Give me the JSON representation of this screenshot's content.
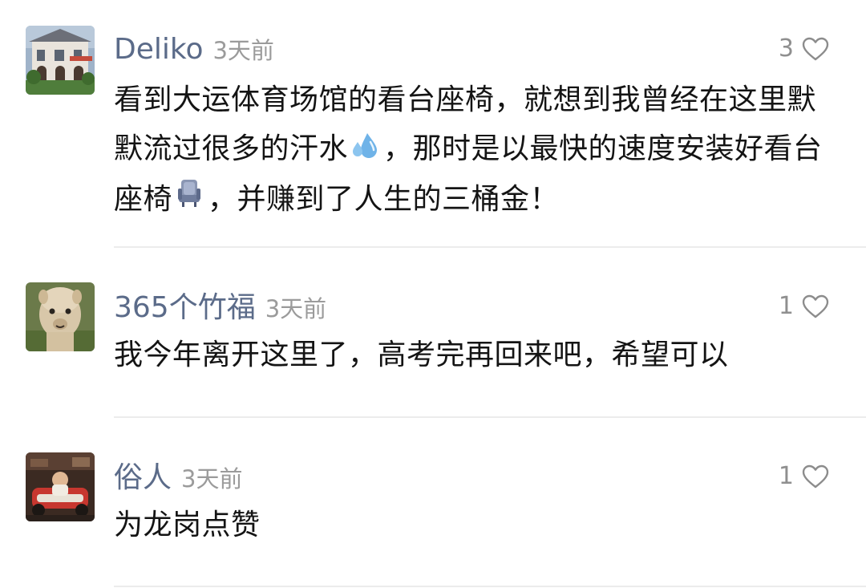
{
  "comments": [
    {
      "username": "Deliko",
      "time": "3天前",
      "likes": "3",
      "content": {
        "part1": "看到大运体育场馆的看台座椅，就想到我曾经在这里默默流过很多的汗水",
        "part2": "，那时是以最快的速度安装好看台座椅",
        "part3": "，并赚到了人生的三桶金！"
      },
      "emoji_1": "sweat-droplets-icon",
      "emoji_2": "seat-icon"
    },
    {
      "username": "365个竹福",
      "time": "3天前",
      "likes": "1",
      "content": "我今年离开这里了，高考完再回来吧，希望可以"
    },
    {
      "username": "俗人",
      "time": "3天前",
      "likes": "1",
      "content": "为龙岗点赞"
    }
  ],
  "colors": {
    "username": "#5b6b89",
    "time": "#9b9b9b",
    "text": "#141414",
    "divider": "#ececec"
  }
}
